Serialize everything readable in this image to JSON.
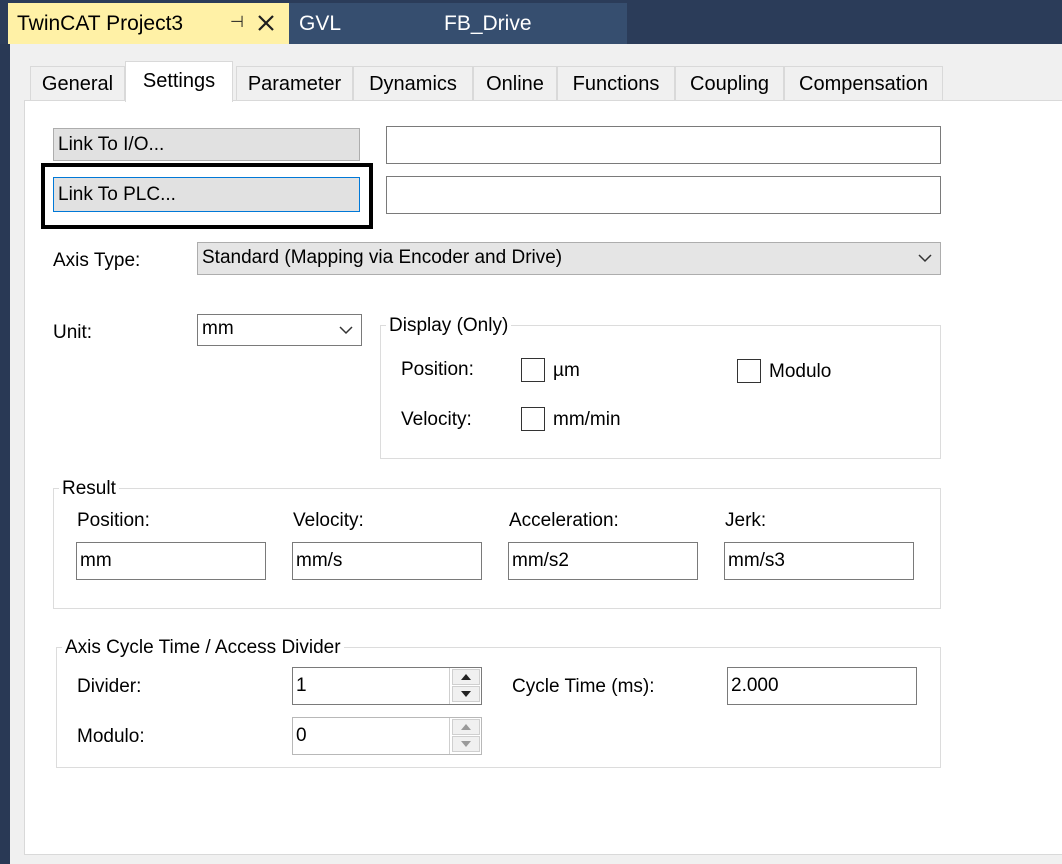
{
  "tabs": {
    "active": "TwinCAT Project3",
    "others": [
      "GVL",
      "FB_Drive"
    ]
  },
  "property_tabs": [
    "General",
    "Settings",
    "Parameter",
    "Dynamics",
    "Online",
    "Functions",
    "Coupling",
    "Compensation"
  ],
  "selected_tab": "Settings",
  "links": {
    "io_button": "Link To I/O...",
    "io_value": "",
    "plc_button": "Link To PLC...",
    "plc_value": ""
  },
  "axis_type": {
    "label": "Axis Type:",
    "value": "Standard (Mapping via Encoder and Drive)"
  },
  "unit": {
    "label": "Unit:",
    "value": "mm"
  },
  "display": {
    "title": "Display (Only)",
    "position_label": "Position:",
    "velocity_label": "Velocity:",
    "um_label": "µm",
    "um_checked": false,
    "modulo_label": "Modulo",
    "modulo_checked": false,
    "mm_min_label": "mm/min",
    "mm_min_checked": false
  },
  "result": {
    "title": "Result",
    "position_label": "Position:",
    "position_value": "mm",
    "velocity_label": "Velocity:",
    "velocity_value": "mm/s",
    "acceleration_label": "Acceleration:",
    "acceleration_value": "mm/s2",
    "jerk_label": "Jerk:",
    "jerk_value": "mm/s3"
  },
  "cycle": {
    "title": "Axis Cycle Time / Access Divider",
    "divider_label": "Divider:",
    "divider_value": "1",
    "modulo_label": "Modulo:",
    "modulo_value": "0",
    "cycle_time_label": "Cycle Time (ms):",
    "cycle_time_value": "2.000"
  },
  "colors": {
    "active_tab": "#fff1a6",
    "inactive_tab": "#364e6f",
    "chrome": "#293955",
    "focus_border": "#0078d7"
  }
}
